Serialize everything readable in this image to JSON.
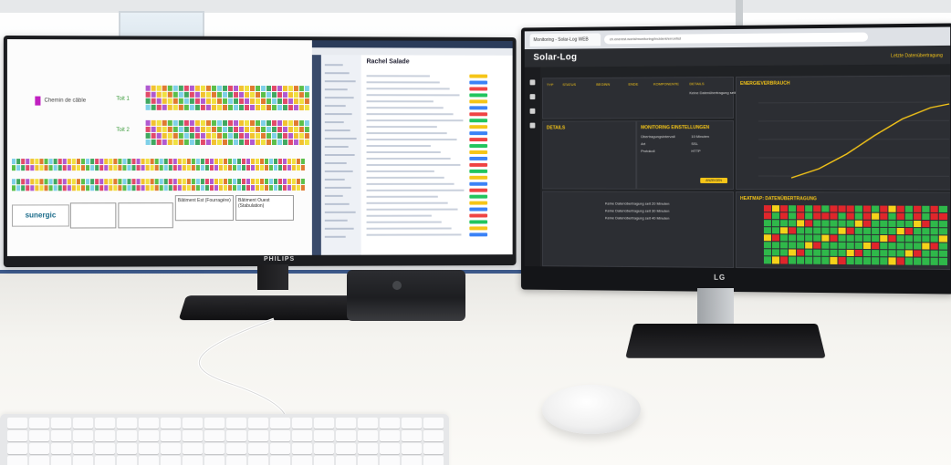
{
  "left_monitor": {
    "brand": "PHILIPS",
    "plan": {
      "legend_text": "Chemin de câble",
      "labels": [
        "Toit 1",
        "Toit 2"
      ],
      "logo_text": "sunergic",
      "box_titles": [
        "Bâtiment Est (Fourragère)",
        "Bâtiment Ouest (Stabulation)"
      ]
    },
    "app": {
      "title": "Rachel Salade"
    }
  },
  "right_monitor": {
    "brand": "LG",
    "browser": {
      "tab_label": "Monitoring - Solar-Log WEB",
      "url": "ch.enerest.world/monitoring/incident/error/list"
    },
    "solarlog": {
      "logo": "Solar-Log",
      "header_link": "Letzte Datenübertragung",
      "panels": {
        "consumption": "ENERGIEVERBRAUCH",
        "details": "DETAILS",
        "monitoring": "MONITORING EINSTELLUNGEN",
        "heatmap": "HEATMAP: DATENÜBERTRAGUNG"
      },
      "columns": [
        "TYP",
        "STATUS",
        "BEGINN",
        "ENDE",
        "KOMPONENTE",
        "DETAILS"
      ],
      "row_detail": "Keine Datenübertragung seit 10 h",
      "monitor_rows": [
        {
          "label": "Übertragungsintervall",
          "value": "10 Minuten"
        },
        {
          "label": "Art",
          "value": "SSL"
        },
        {
          "label": "Protokoll",
          "value": "HTTP"
        }
      ],
      "list_rows": [
        "Keine Datenübertragung seit 20 Minuten",
        "Keine Datenübertragung seit 30 Minuten",
        "Keine Datenübertragung seit 40 Minuten"
      ],
      "button_label": "ANZEIGEN"
    }
  },
  "colors": {
    "accent": "#f5c518",
    "heat_green": "#2fb84a",
    "heat_red": "#e0262b",
    "heat_yellow": "#f5d21a"
  }
}
